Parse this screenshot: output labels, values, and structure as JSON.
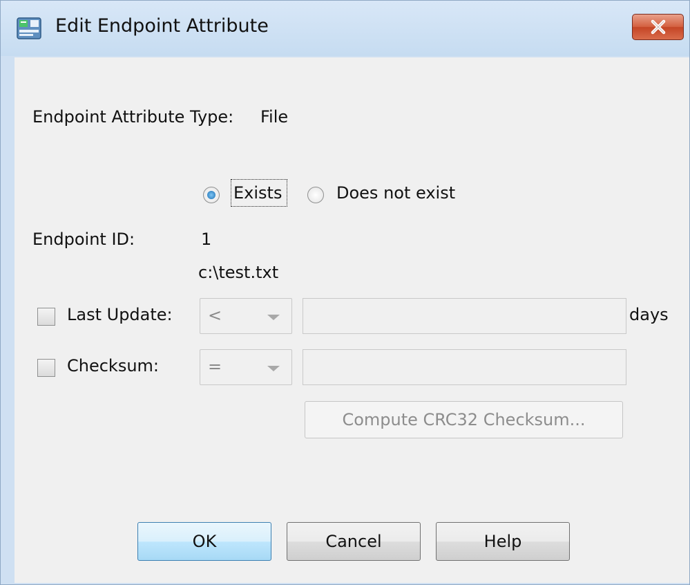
{
  "window": {
    "title": "Edit Endpoint Attribute",
    "close_label": "X",
    "icon": "adsm-app-icon"
  },
  "form": {
    "attribute_type_label": "Endpoint Attribute Type:",
    "attribute_type_value": "File",
    "radio_exists": "Exists",
    "radio_not_exist": "Does not exist",
    "radio_selected": "Exists",
    "endpoint_id_label": "Endpoint ID:",
    "endpoint_id_value": "1",
    "path": "c:\\test.txt",
    "last_update": {
      "label": "Last Update:",
      "checked": false,
      "operator": "<",
      "value": "",
      "unit": "days"
    },
    "checksum": {
      "label": "Checksum:",
      "checked": false,
      "operator": "=",
      "value": ""
    },
    "compute_button": "Compute CRC32 Checksum..."
  },
  "buttons": {
    "ok": "OK",
    "cancel": "Cancel",
    "help": "Help"
  },
  "colors": {
    "titlebar": "#c6dcf1",
    "close_button": "#c44526",
    "client": "#f0f0f0",
    "default_button": "#bee6fd"
  }
}
